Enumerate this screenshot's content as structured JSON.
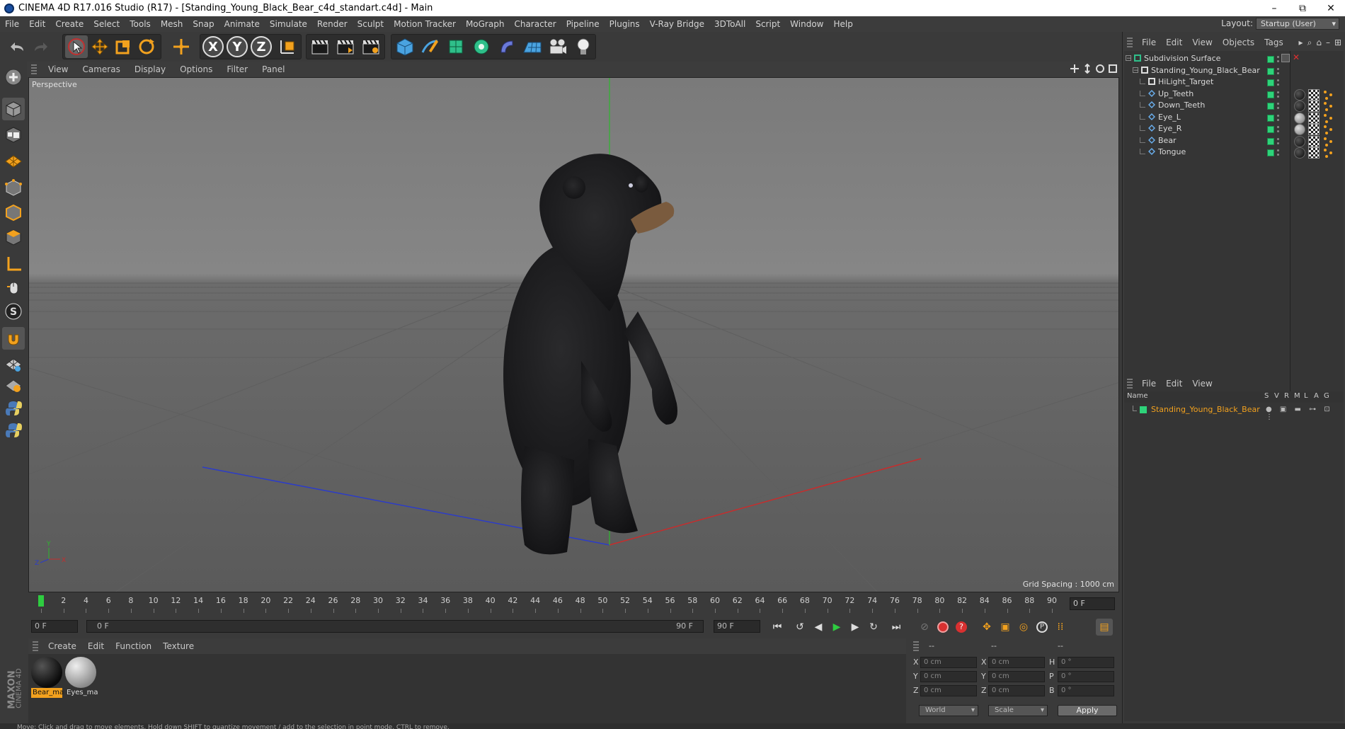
{
  "window": {
    "title": "CINEMA 4D R17.016 Studio (R17) - [Standing_Young_Black_Bear_c4d_standart.c4d] - Main",
    "minimize": "–",
    "restore": "⧉",
    "close": "✕"
  },
  "menubar": {
    "items": [
      "File",
      "Edit",
      "Create",
      "Select",
      "Tools",
      "Mesh",
      "Snap",
      "Animate",
      "Simulate",
      "Render",
      "Sculpt",
      "Motion Tracker",
      "MoGraph",
      "Character",
      "Pipeline",
      "Plugins",
      "V-Ray Bridge",
      "3DToAll",
      "Script",
      "Window",
      "Help"
    ],
    "layout_label": "Layout:",
    "layout_value": "Startup (User)"
  },
  "toolbar": {
    "axis": [
      "X",
      "Y",
      "Z"
    ]
  },
  "viewport": {
    "menus": [
      "View",
      "Cameras",
      "Display",
      "Options",
      "Filter",
      "Panel"
    ],
    "label": "Perspective",
    "grid_spacing": "Grid Spacing : 1000 cm",
    "axis_labels": {
      "y": "Y",
      "z": "Z",
      "x": "X"
    }
  },
  "timeline": {
    "ticks": [
      0,
      2,
      4,
      6,
      8,
      10,
      12,
      14,
      16,
      18,
      20,
      22,
      24,
      26,
      28,
      30,
      32,
      34,
      36,
      38,
      40,
      42,
      44,
      46,
      48,
      50,
      52,
      54,
      56,
      58,
      60,
      62,
      64,
      66,
      68,
      70,
      72,
      74,
      76,
      78,
      80,
      82,
      84,
      86,
      88,
      90
    ],
    "current_frame": "0 F"
  },
  "transport": {
    "start_field": "0 F",
    "range_start": "0 F",
    "range_end": "90 F",
    "end_field": "90 F"
  },
  "materials": {
    "menus": [
      "Create",
      "Edit",
      "Function",
      "Texture"
    ],
    "items": [
      {
        "name": "Bear_ma",
        "selected": true
      },
      {
        "name": "Eyes_ma",
        "selected": false
      }
    ]
  },
  "coordinates": {
    "headers": [
      "--",
      "--",
      "--"
    ],
    "rows": [
      {
        "axis": "X",
        "pos": "0 cm",
        "axis2": "X",
        "size": "0 cm",
        "rot_label": "H",
        "rot": "0 °"
      },
      {
        "axis": "Y",
        "pos": "0 cm",
        "axis2": "Y",
        "size": "0 cm",
        "rot_label": "P",
        "rot": "0 °"
      },
      {
        "axis": "Z",
        "pos": "0 cm",
        "axis2": "Z",
        "size": "0 cm",
        "rot_label": "B",
        "rot": "0 °"
      }
    ],
    "mode1": "World",
    "mode2": "Scale",
    "apply": "Apply"
  },
  "object_manager": {
    "menus": [
      "File",
      "Edit",
      "View",
      "Objects",
      "Tags"
    ],
    "objects": [
      {
        "name": "Subdivision Surface",
        "level": 0,
        "icon": "subdivision-icon"
      },
      {
        "name": "Standing_Young_Black_Bear",
        "level": 1,
        "icon": "null-icon"
      },
      {
        "name": "HiLight_Target",
        "level": 2,
        "icon": "null-icon"
      },
      {
        "name": "Up_Teeth",
        "level": 2,
        "icon": "polygon-icon",
        "tag": "dark"
      },
      {
        "name": "Down_Teeth",
        "level": 2,
        "icon": "polygon-icon",
        "tag": "dark"
      },
      {
        "name": "Eye_L",
        "level": 2,
        "icon": "polygon-icon",
        "tag": "light"
      },
      {
        "name": "Eye_R",
        "level": 2,
        "icon": "polygon-icon",
        "tag": "light"
      },
      {
        "name": "Bear",
        "level": 2,
        "icon": "polygon-icon",
        "tag": "dark"
      },
      {
        "name": "Tongue",
        "level": 2,
        "icon": "polygon-icon",
        "tag": "dark"
      }
    ]
  },
  "layer_manager": {
    "menus": [
      "File",
      "Edit",
      "View"
    ],
    "columns": [
      "Name",
      "S",
      "V",
      "R",
      "M",
      "L",
      "A",
      "G"
    ],
    "layers": [
      {
        "name": "Standing_Young_Black_Bear",
        "color": "#2ed37a"
      }
    ]
  },
  "status": {
    "text": "Move: Click and drag to move elements. Hold down SHIFT to quantize movement / add to the selection in point mode, CTRL to remove."
  },
  "colors": {
    "accent_orange": "#f2a11e",
    "layer_green": "#2ed37a",
    "x_axis": "#c82c2c",
    "y_axis": "#2cb82c",
    "z_axis": "#2c3cc8"
  },
  "logo": {
    "line1": "MAXON",
    "line2": "CINEMA 4D"
  }
}
